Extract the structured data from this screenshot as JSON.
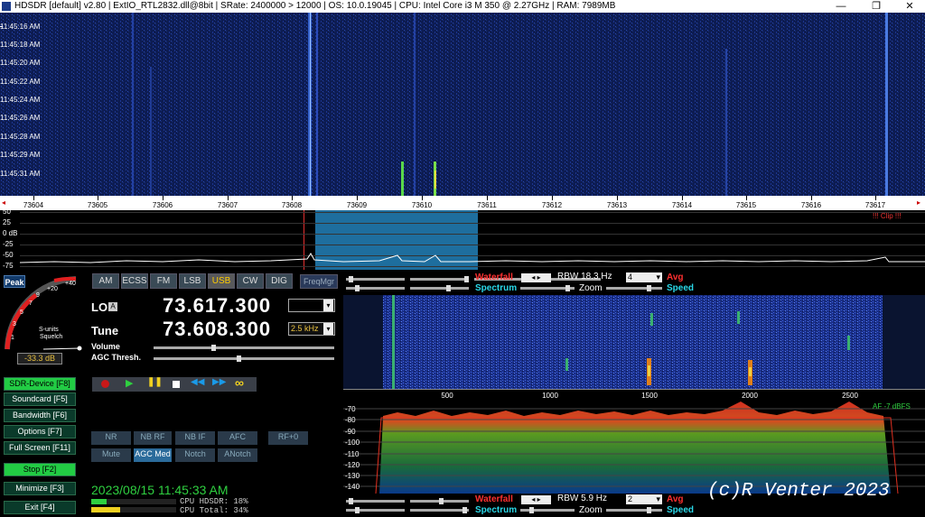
{
  "titlebar": {
    "text": "HDSDR  [default]  v2.80  |  ExtIO_RTL2832.dll@8bit  |  SRate: 2400000 > 12000  |  OS: 10.0.19045  |  CPU: Intel Core i3      M 350  @ 2.27GHz  |  RAM: 7989MB",
    "min": "—",
    "restore": "❐",
    "close": "✕"
  },
  "waterfall": {
    "times": [
      "11:45:16 AM",
      "11:45:18 AM",
      "11:45:20 AM",
      "11:45:22 AM",
      "11:45:24 AM",
      "11:45:26 AM",
      "11:45:28 AM",
      "11:45:29 AM",
      "11:45:31 AM"
    ]
  },
  "freqscale": {
    "labels": [
      "73604",
      "73605",
      "73606",
      "73607",
      "73608",
      "73609",
      "73610",
      "73611",
      "73612",
      "73613",
      "73614",
      "73615",
      "73616",
      "73617"
    ]
  },
  "spectrum": {
    "db_labels": [
      "50",
      "25",
      "0 dB",
      "-25",
      "-50",
      "-75"
    ],
    "clip": "!!! Clip !!!"
  },
  "smeter": {
    "peak": "Peak",
    "scale": [
      "1",
      "3",
      "5",
      "7",
      "9",
      "+20",
      "+40"
    ],
    "title": "S-units",
    "squelch": "Squelch",
    "value": "-33.3 dB"
  },
  "modes": [
    "AM",
    "ECSS",
    "FM",
    "LSB",
    "USB",
    "CW",
    "DIG"
  ],
  "freqmgr": "FreqMgr",
  "lo": {
    "label": "LO",
    "badge": "A",
    "value": "73.617.300"
  },
  "tune": {
    "label": "Tune",
    "value": "73.608.300",
    "step": "2.5 kHz"
  },
  "volume": "Volume",
  "agc_thresh": "AGC Thresh.",
  "side_buttons": [
    {
      "label": "SDR-Device",
      "key": "[F8]"
    },
    {
      "label": "Soundcard",
      "key": "[F5]"
    },
    {
      "label": "Bandwidth",
      "key": "[F6]"
    },
    {
      "label": "Options",
      "key": "[F7]"
    },
    {
      "label": "Full Screen",
      "key": "[F11]"
    },
    {
      "label": "Stop",
      "key": "[F2]"
    },
    {
      "label": "Minimize",
      "key": "[F3]"
    },
    {
      "label": "Exit",
      "key": "[F4]"
    }
  ],
  "dsp1": [
    "NR",
    "NB RF",
    "NB IF",
    "AFC",
    "RF+0"
  ],
  "dsp2": [
    "Mute",
    "AGC Med",
    "Notch",
    "ANotch"
  ],
  "datetime": "2023/08/15 11:45:33 AM",
  "cpu": {
    "hdsdr": "CPU HDSDR: 18%",
    "total": "CPU Total: 34%",
    "hdsdr_level": 0.18,
    "total_level": 0.34
  },
  "controls_top": {
    "waterfall": "Waterfall",
    "rbw": "RBW 18.3 Hz",
    "rbw_sel": "4",
    "avg": "Avg",
    "spectrum": "Spectrum",
    "zoom": "Zoom",
    "speed": "Speed"
  },
  "afscale": {
    "labels": [
      "500",
      "1000",
      "1500",
      "2000",
      "2500"
    ]
  },
  "afspec": {
    "db_labels": [
      "-70",
      "-80",
      "-90",
      "-100",
      "-110",
      "-120",
      "-130",
      "-140"
    ],
    "af": "AF  -7 dBFS"
  },
  "controls_bottom": {
    "waterfall": "Waterfall",
    "rbw": "RBW  5.9 Hz",
    "rbw_sel": "2",
    "avg": "Avg",
    "spectrum": "Spectrum",
    "zoom": "Zoom",
    "speed": "Speed"
  },
  "watermark": "(c)R Venter 2023",
  "colors": {
    "accent": "#22cc44",
    "waterfall_bg": "#0c1a4a",
    "filter": "#1e6e9e",
    "spectrum_red": "#d03020"
  }
}
